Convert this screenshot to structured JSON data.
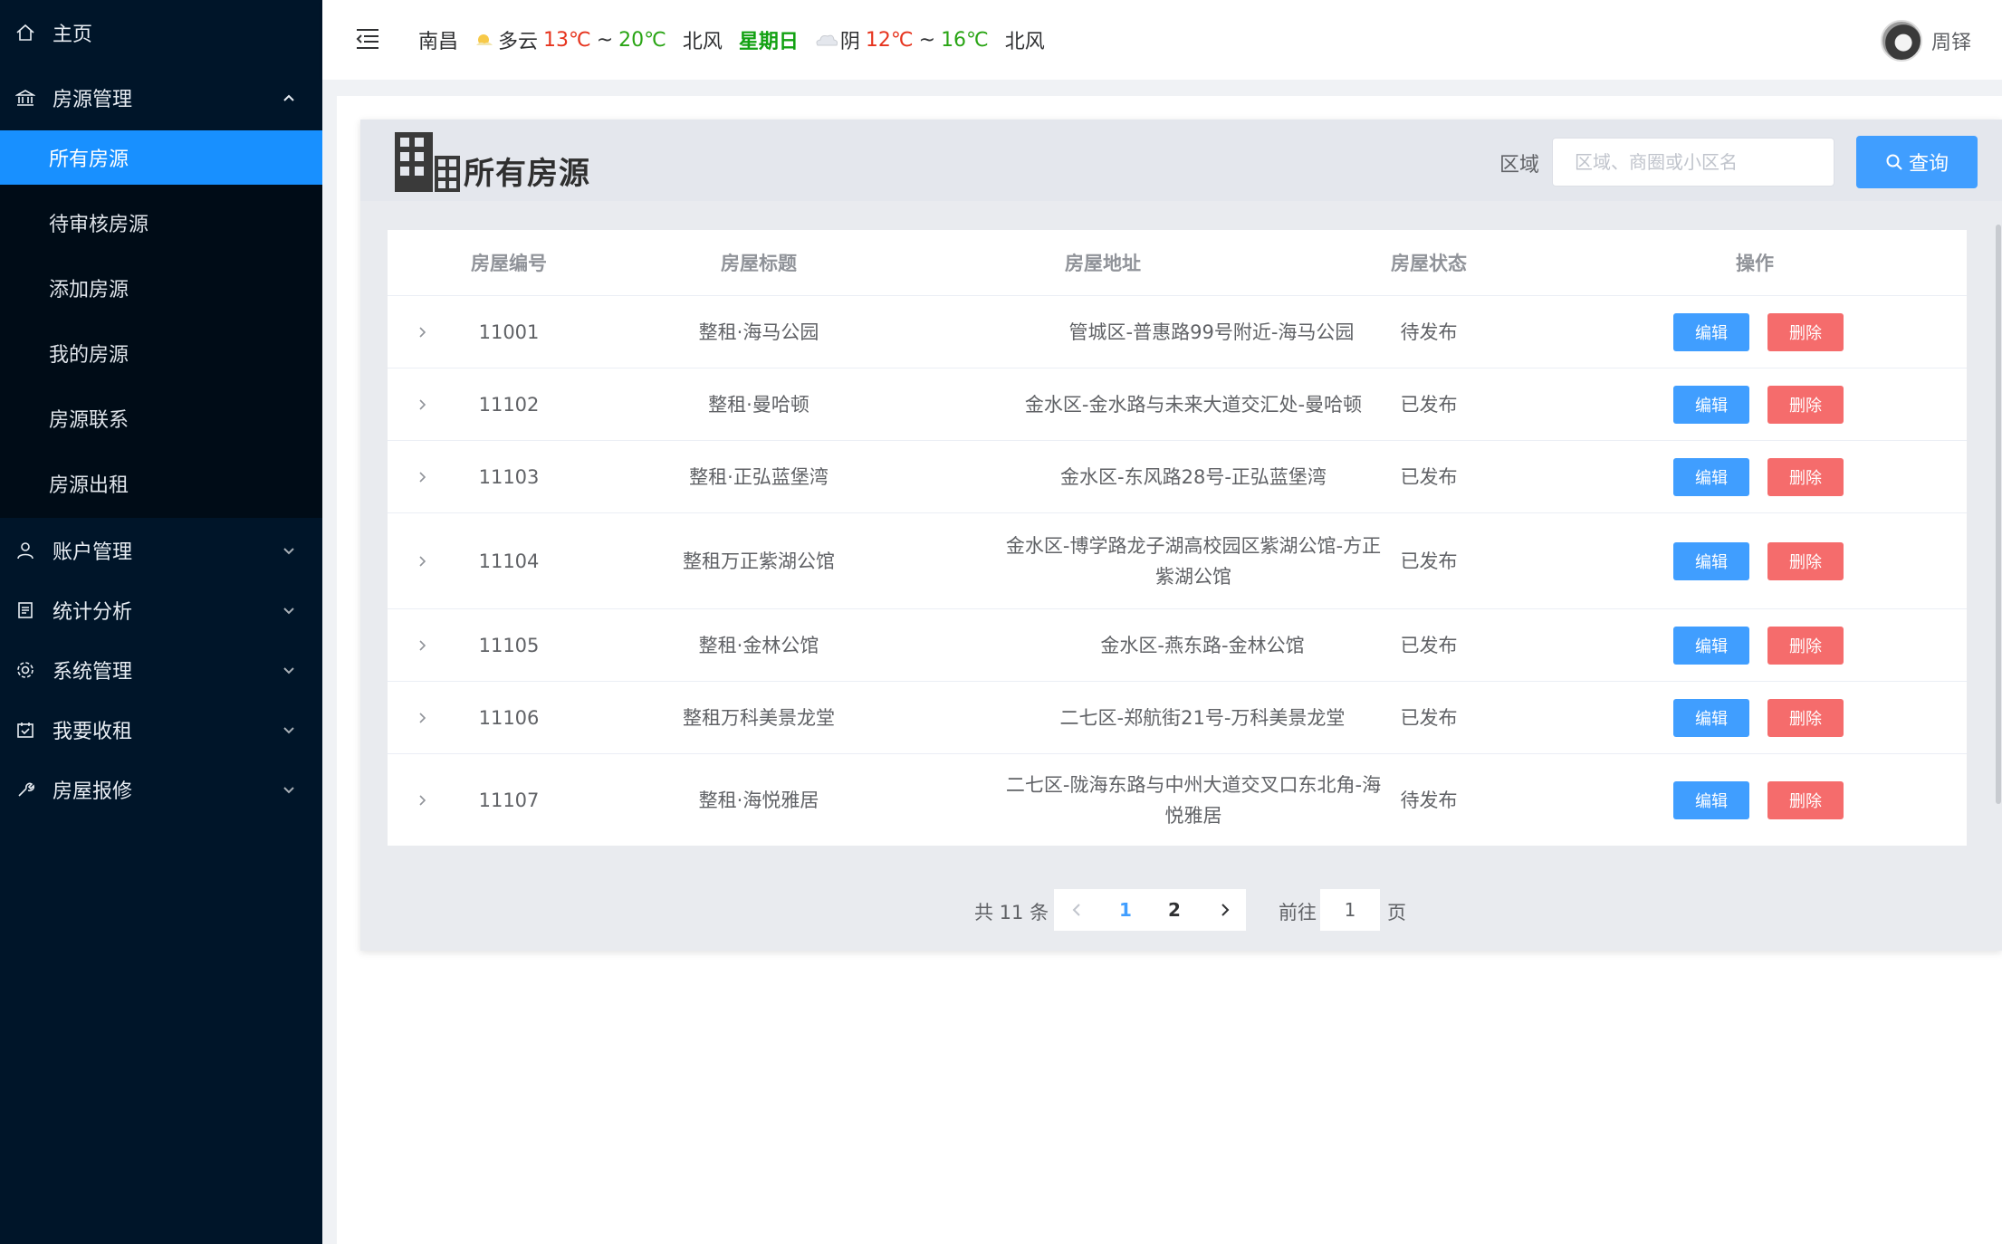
{
  "sidebar": {
    "home": "主页",
    "housing_mgmt": "房源管理",
    "sub_items": [
      "所有房源",
      "待审核房源",
      "添加房源",
      "我的房源",
      "房源联系",
      "房源出租"
    ],
    "account_mgmt": "账户管理",
    "stats": "统计分析",
    "system_mgmt": "系统管理",
    "rent_collect": "我要收租",
    "repair": "房屋报修"
  },
  "header": {
    "city": "南昌",
    "today_weather": "多云",
    "today_low": "13℃",
    "today_sep": "~",
    "today_high": "20℃",
    "today_wind": "北风",
    "weekday": "星期日",
    "tomorrow_weather": "阴",
    "tomorrow_low": "12℃",
    "tomorrow_sep": "~",
    "tomorrow_high": "16℃",
    "tomorrow_wind": "北风",
    "user_name": "周铎"
  },
  "page": {
    "title": "所有房源",
    "area_label": "区域",
    "search_placeholder": "区域、商圈或小区名",
    "search_button": "查询"
  },
  "table": {
    "headers": [
      "房屋编号",
      "房屋标题",
      "房屋地址",
      "房屋状态",
      "操作"
    ],
    "edit_label": "编辑",
    "delete_label": "删除",
    "rows": [
      {
        "id": "11001",
        "title": "整租·海马公园",
        "address": "管城区-普惠路99号附近-海马公园",
        "status": "待发布"
      },
      {
        "id": "11102",
        "title": "整租·曼哈顿",
        "address": "金水区-金水路与未来大道交汇处-曼哈顿",
        "status": "已发布"
      },
      {
        "id": "11103",
        "title": "整租·正弘蓝堡湾",
        "address": "金水区-东风路28号-正弘蓝堡湾",
        "status": "已发布"
      },
      {
        "id": "11104",
        "title": "整租万正紫湖公馆",
        "address": "金水区-博学路龙子湖高校园区紫湖公馆-方正紫湖公馆",
        "status": "已发布"
      },
      {
        "id": "11105",
        "title": "整租·金林公馆",
        "address": "金水区-燕东路-金林公馆",
        "status": "已发布"
      },
      {
        "id": "11106",
        "title": "整租万科美景龙堂",
        "address": "二七区-郑航街21号-万科美景龙堂",
        "status": "已发布"
      },
      {
        "id": "11107",
        "title": "整租·海悦雅居",
        "address": "二七区-陇海东路与中州大道交叉口东北角-海悦雅居",
        "status": "待发布"
      }
    ]
  },
  "pagination": {
    "total": "共 11 条",
    "page1": "1",
    "page2": "2",
    "goto_label": "前往",
    "goto_value": "1",
    "page_suffix": "页",
    "current_page": 1
  },
  "colors": {
    "sidebar_bg": "#001529",
    "active": "#1890ff",
    "primary": "#409eff",
    "danger": "#f56c6c",
    "temp_low": "#e6341e",
    "temp_high": "#2aa515"
  }
}
